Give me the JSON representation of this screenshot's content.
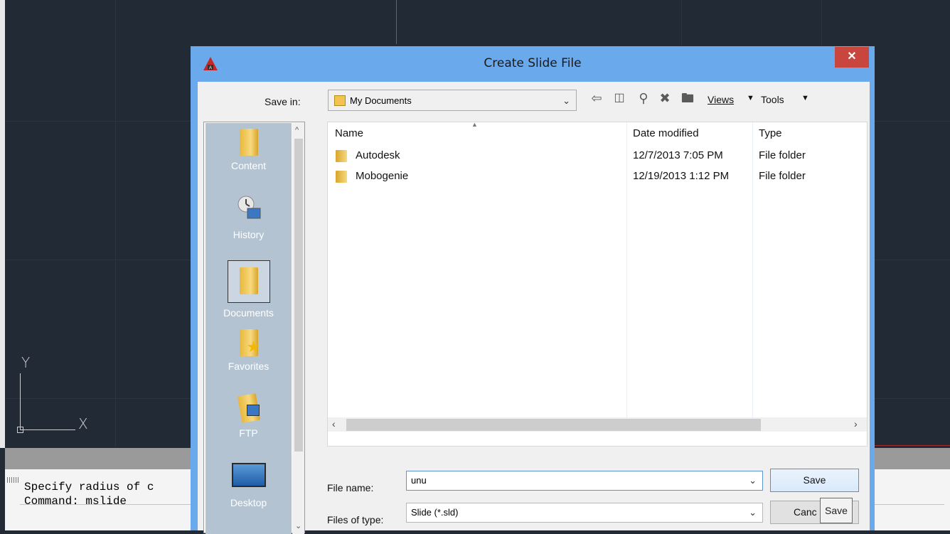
{
  "cad": {
    "ucs_y": "Y",
    "ucs_x": "X",
    "command_lines": [
      "Specify radius of c",
      "Command: mslide"
    ]
  },
  "dialog": {
    "title": "Create Slide File",
    "close_glyph": "✕",
    "save_in_label": "Save in:",
    "save_in_value": "My Documents",
    "views_label": "Views",
    "tools_label": "Tools",
    "places": [
      {
        "label": "Content"
      },
      {
        "label": "History"
      },
      {
        "label": "Documents"
      },
      {
        "label": "Favorites"
      },
      {
        "label": "FTP"
      },
      {
        "label": "Desktop"
      }
    ],
    "columns": {
      "name": "Name",
      "date": "Date modified",
      "type": "Type"
    },
    "files": [
      {
        "name": "Autodesk",
        "date": "12/7/2013 7:05 PM",
        "type": "File folder"
      },
      {
        "name": "Mobogenie",
        "date": "12/19/2013 1:12 PM",
        "type": "File folder"
      }
    ],
    "file_name_label": "File name:",
    "file_name_value": "unu",
    "files_of_type_label": "Files of type:",
    "files_of_type_value": "Slide (*.sld)",
    "save_button": "Save",
    "cancel_button": "Canc",
    "tooltip": "Save"
  }
}
